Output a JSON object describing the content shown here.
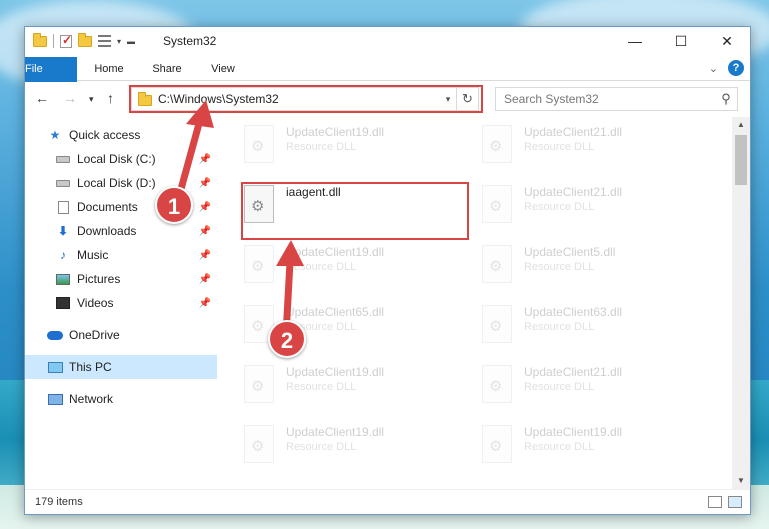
{
  "window": {
    "title": "System32",
    "controls": {
      "minimize": "—",
      "maximize": "☐",
      "close": "✕"
    }
  },
  "ribbon": {
    "tabs": [
      "File",
      "Home",
      "Share",
      "View"
    ],
    "help": "?"
  },
  "nav": {
    "address": "C:\\Windows\\System32",
    "search_placeholder": "Search System32"
  },
  "sidebar": {
    "items": [
      {
        "label": "Quick access",
        "icon": "star-icon"
      },
      {
        "label": "Local Disk (C:)",
        "icon": "disk-icon",
        "pinned": true
      },
      {
        "label": "Local Disk (D:)",
        "icon": "disk-icon",
        "pinned": true
      },
      {
        "label": "Documents",
        "icon": "documents-icon",
        "pinned": true
      },
      {
        "label": "Downloads",
        "icon": "downloads-icon",
        "pinned": true
      },
      {
        "label": "Music",
        "icon": "music-icon",
        "pinned": true
      },
      {
        "label": "Pictures",
        "icon": "pictures-icon",
        "pinned": true
      },
      {
        "label": "Videos",
        "icon": "videos-icon",
        "pinned": true
      },
      {
        "label": "OneDrive",
        "icon": "onedrive-icon"
      },
      {
        "label": "This PC",
        "icon": "this-pc-icon",
        "selected": true
      },
      {
        "label": "Network",
        "icon": "network-icon"
      }
    ]
  },
  "files": {
    "left": [
      {
        "name": "UpdateClient19.dll",
        "desc": "Resource DLL"
      },
      {
        "name": "iaagent.dll",
        "desc": ""
      },
      {
        "name": "UpdateClient19.dll",
        "desc": "Resource DLL"
      },
      {
        "name": "UpdateClient65.dll",
        "desc": "Resource DLL"
      },
      {
        "name": "UpdateClient19.dll",
        "desc": "Resource DLL"
      },
      {
        "name": "UpdateClient19.dll",
        "desc": "Resource DLL"
      }
    ],
    "right": [
      {
        "name": "UpdateClient21.dll",
        "desc": "Resource DLL"
      },
      {
        "name": "UpdateClient21.dll",
        "desc": "Resource DLL"
      },
      {
        "name": "UpdateClient5.dll",
        "desc": "Resource DLL"
      },
      {
        "name": "UpdateClient63.dll",
        "desc": "Resource DLL"
      },
      {
        "name": "UpdateClient21.dll",
        "desc": "Resource DLL"
      },
      {
        "name": "UpdateClient19.dll",
        "desc": "Resource DLL"
      }
    ]
  },
  "status": {
    "count": "179 items"
  },
  "callouts": {
    "one": "1",
    "two": "2"
  },
  "colors": {
    "accent": "#1979ca",
    "highlight": "#d94545",
    "selection": "#cce8ff"
  }
}
